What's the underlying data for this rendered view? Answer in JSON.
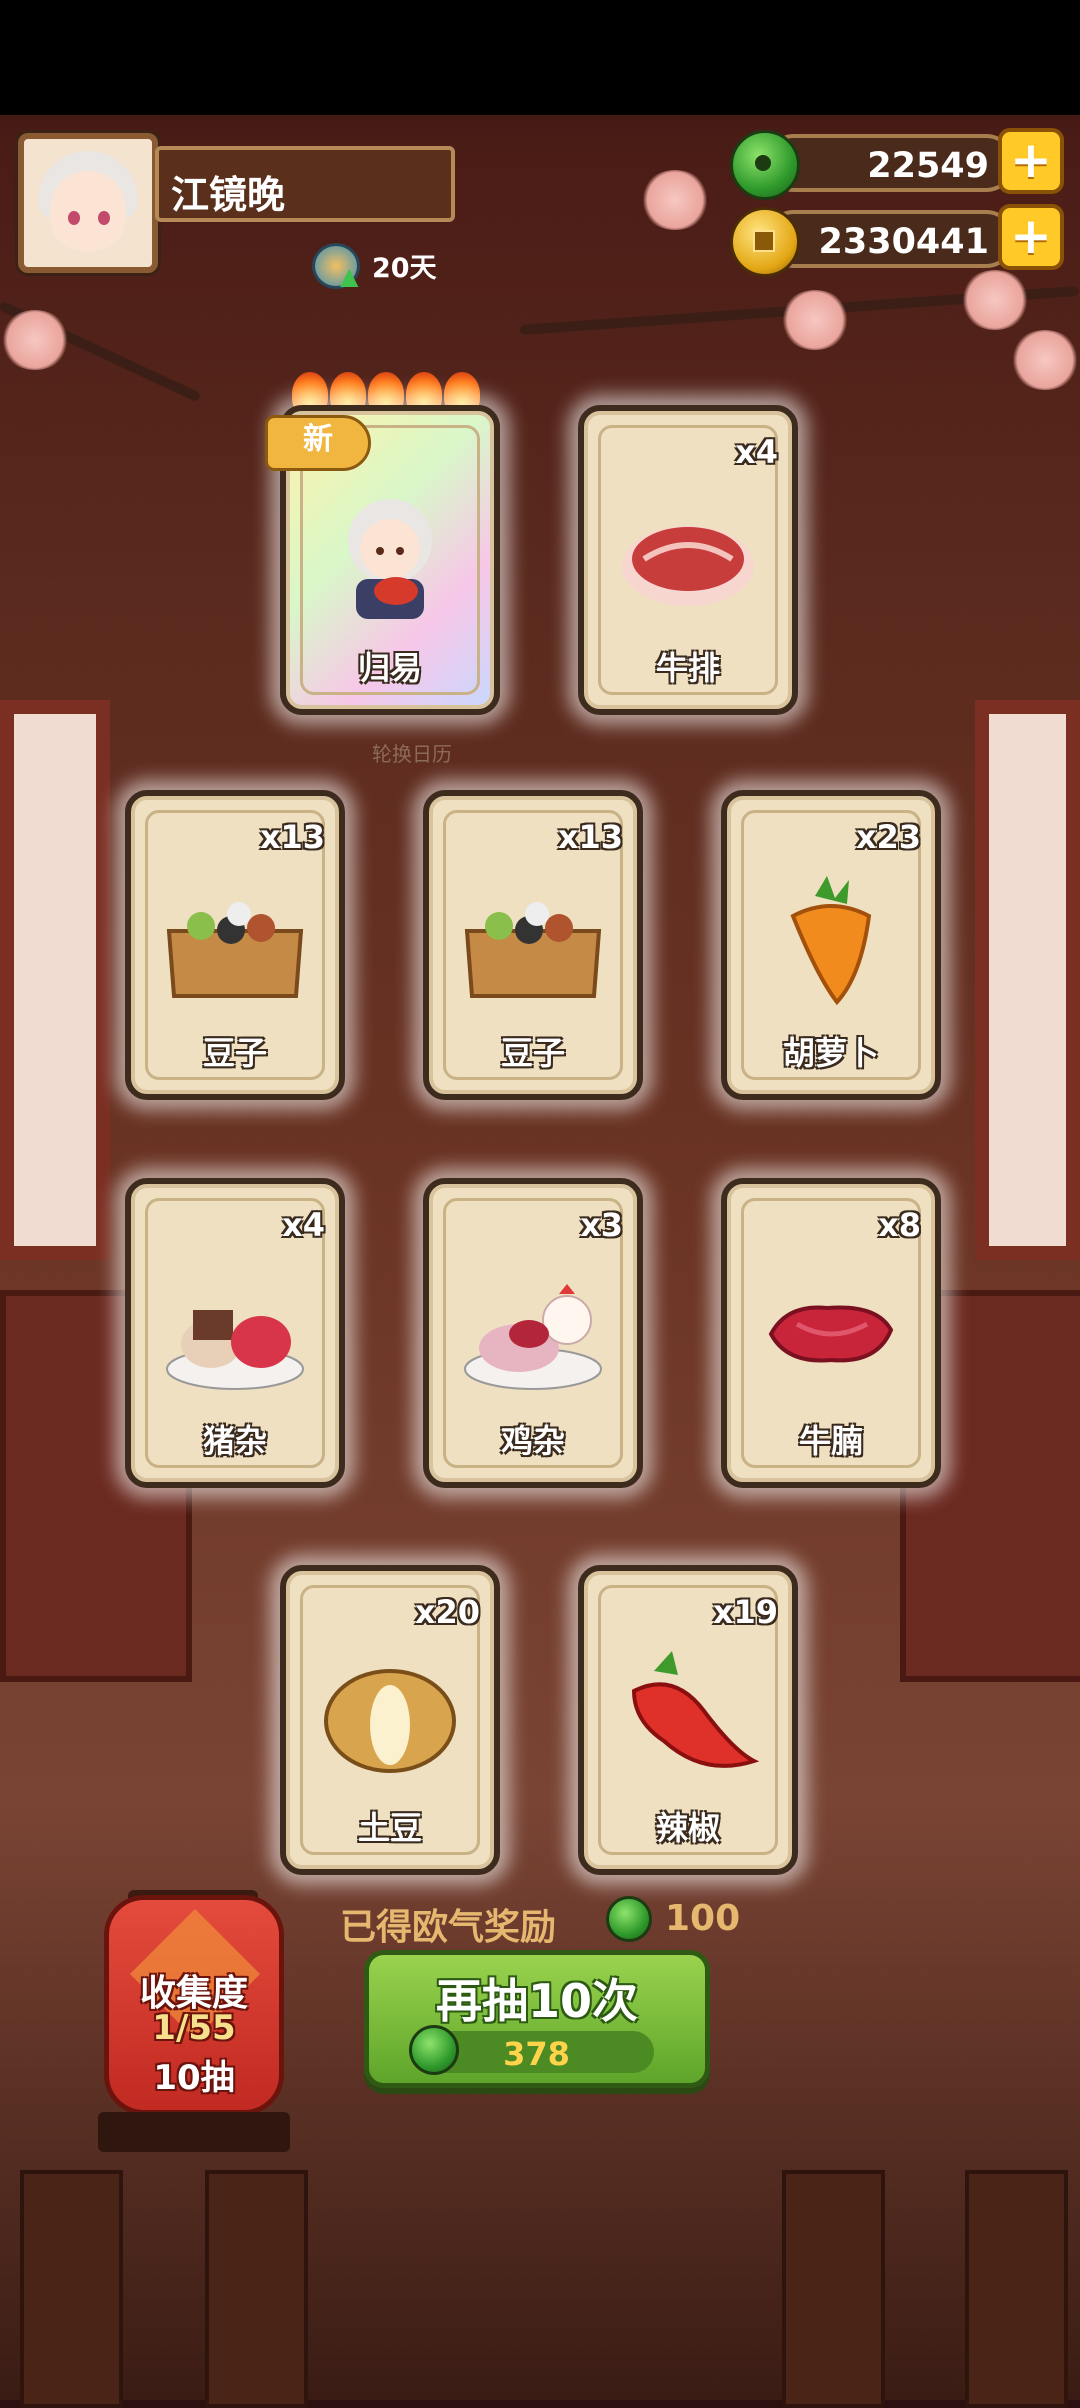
{
  "player": {
    "name": "江镜晚",
    "days": "20天"
  },
  "currency": {
    "jade": "22549",
    "gold": "2330441",
    "plus_symbol": "+"
  },
  "hint": "轮换日历",
  "cards": [
    {
      "label": "归易",
      "count": "",
      "is_new": true,
      "new_label": "新",
      "stars": 5
    },
    {
      "label": "牛排",
      "count": "x4"
    },
    {
      "label": "豆子",
      "count": "x13"
    },
    {
      "label": "豆子",
      "count": "x13"
    },
    {
      "label": "胡萝卜",
      "count": "x23"
    },
    {
      "label": "猪杂",
      "count": "x4"
    },
    {
      "label": "鸡杂",
      "count": "x3"
    },
    {
      "label": "牛腩",
      "count": "x8"
    },
    {
      "label": "土豆",
      "count": "x20"
    },
    {
      "label": "辣椒",
      "count": "x19"
    }
  ],
  "reward": {
    "text": "已得欧气奖励",
    "value": "100"
  },
  "draw_button": {
    "label": "再抽10次",
    "cost": "378"
  },
  "collection": {
    "title": "收集度",
    "progress": "1/55",
    "draws": "10抽"
  },
  "colors": {
    "accent_green": "#5ea52a",
    "gold": "#ffc928",
    "card_bg": "#eee0c0"
  }
}
